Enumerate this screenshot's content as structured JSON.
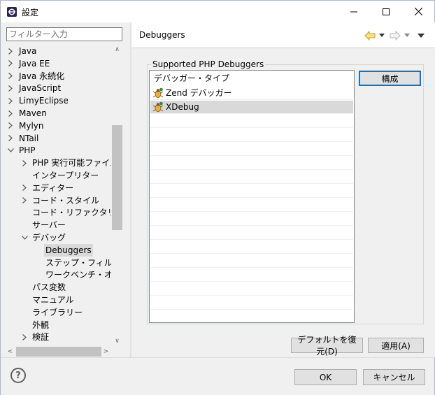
{
  "window": {
    "title": "設定",
    "icons": {
      "app": "eclipse-icon",
      "minimize": "minimize-icon",
      "maximize": "maximize-icon",
      "close": "close-icon"
    }
  },
  "sidebar": {
    "filter_placeholder": "フィルター入力",
    "tree": [
      {
        "label": "Java",
        "level": 0,
        "arrow": "collapsed",
        "selected": false
      },
      {
        "label": "Java EE",
        "level": 0,
        "arrow": "collapsed",
        "selected": false
      },
      {
        "label": "Java 永続化",
        "level": 0,
        "arrow": "collapsed",
        "selected": false
      },
      {
        "label": "JavaScript",
        "level": 0,
        "arrow": "collapsed",
        "selected": false
      },
      {
        "label": "LimyEclipse",
        "level": 0,
        "arrow": "collapsed",
        "selected": false
      },
      {
        "label": "Maven",
        "level": 0,
        "arrow": "collapsed",
        "selected": false
      },
      {
        "label": "Mylyn",
        "level": 0,
        "arrow": "collapsed",
        "selected": false
      },
      {
        "label": "NTail",
        "level": 0,
        "arrow": "collapsed",
        "selected": false
      },
      {
        "label": "PHP",
        "level": 0,
        "arrow": "expanded",
        "selected": false
      },
      {
        "label": "PHP 実行可能ファイル",
        "level": 1,
        "arrow": "collapsed",
        "selected": false
      },
      {
        "label": "インタープリター",
        "level": 1,
        "arrow": "none",
        "selected": false
      },
      {
        "label": "エディター",
        "level": 1,
        "arrow": "collapsed",
        "selected": false
      },
      {
        "label": "コード・スタイル",
        "level": 1,
        "arrow": "collapsed",
        "selected": false
      },
      {
        "label": "コード・リファクタリング",
        "level": 1,
        "arrow": "none",
        "selected": false
      },
      {
        "label": "サーバー",
        "level": 1,
        "arrow": "none",
        "selected": false
      },
      {
        "label": "デバッグ",
        "level": 1,
        "arrow": "expanded",
        "selected": false
      },
      {
        "label": "Debuggers",
        "level": 2,
        "arrow": "none",
        "selected": true
      },
      {
        "label": "ステップ・フィルター",
        "level": 2,
        "arrow": "none",
        "selected": false
      },
      {
        "label": "ワークベンチ・オプシ",
        "level": 2,
        "arrow": "none",
        "selected": false
      },
      {
        "label": "パス変数",
        "level": 1,
        "arrow": "none",
        "selected": false
      },
      {
        "label": "マニュアル",
        "level": 1,
        "arrow": "none",
        "selected": false
      },
      {
        "label": "ライブラリー",
        "level": 1,
        "arrow": "none",
        "selected": false
      },
      {
        "label": "外観",
        "level": 1,
        "arrow": "none",
        "selected": false
      },
      {
        "label": "検証",
        "level": 1,
        "arrow": "collapsed",
        "selected": false
      }
    ]
  },
  "main": {
    "title": "Debuggers",
    "nav_icons": {
      "back": "back-arrow-icon",
      "back_menu": "dropdown-icon",
      "forward": "forward-arrow-icon",
      "forward_menu": "dropdown-icon",
      "view_menu": "view-menu-icon"
    },
    "group_label": "Supported PHP Debuggers",
    "list_header": "デバッガー・タイプ",
    "debuggers": [
      {
        "label": "Zend デバッガー",
        "icon": "debugger-bug-icon",
        "selected": false
      },
      {
        "label": "XDebug",
        "icon": "debugger-bug-icon",
        "selected": true
      }
    ],
    "configure_button": "構成",
    "restore_defaults_button": "デフォルトを復元(D)",
    "apply_button": "適用(A)"
  },
  "footer": {
    "help_icon": "help-icon",
    "ok_button": "OK",
    "cancel_button": "キャンセル"
  }
}
